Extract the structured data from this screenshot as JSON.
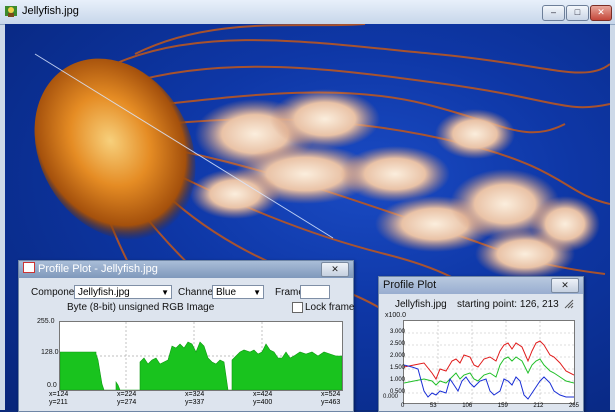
{
  "window": {
    "title": "Jellyfish.jpg",
    "buttons": [
      "–",
      "□",
      "✕"
    ]
  },
  "profile_plot_1": {
    "title": "Profile Plot - Jellyfish.jpg",
    "close_label": "✕",
    "component_label": "Component",
    "component_value": "Jellyfish.jpg",
    "channel_label": "Channel",
    "channel_value": "Blue",
    "frame_label": "Frame",
    "frame_value": "",
    "image_info": "Byte (8-bit) unsigned RGB Image",
    "lock_frame_label": "Lock frame",
    "lock_frame_checked": false,
    "y_ticks": [
      "255.0",
      "128.0",
      "0.0"
    ],
    "x_ticks": [
      {
        "x": "x=124",
        "y": "y=211"
      },
      {
        "x": "x=224",
        "y": "y=274"
      },
      {
        "x": "x=324",
        "y": "y=337"
      },
      {
        "x": "x=424",
        "y": "y=400"
      },
      {
        "x": "x=524",
        "y": "y=463"
      }
    ],
    "color": "#19c31e"
  },
  "profile_plot_2": {
    "title": "Profile Plot",
    "close_label": "✕",
    "filename": "Jellyfish.jpg",
    "starting_point": "starting point: 126, 213",
    "y_unit": "x100.0",
    "y_ticks": [
      "3.000",
      "2.500",
      "2.000",
      "1.500",
      "1.000",
      "0.500",
      "0.000"
    ],
    "x_ticks": [
      "0",
      "53",
      "106",
      "159",
      "212",
      "265"
    ],
    "colors": {
      "red": "#e01b1b",
      "green": "#22c02a",
      "blue": "#1a2fd6"
    }
  }
}
